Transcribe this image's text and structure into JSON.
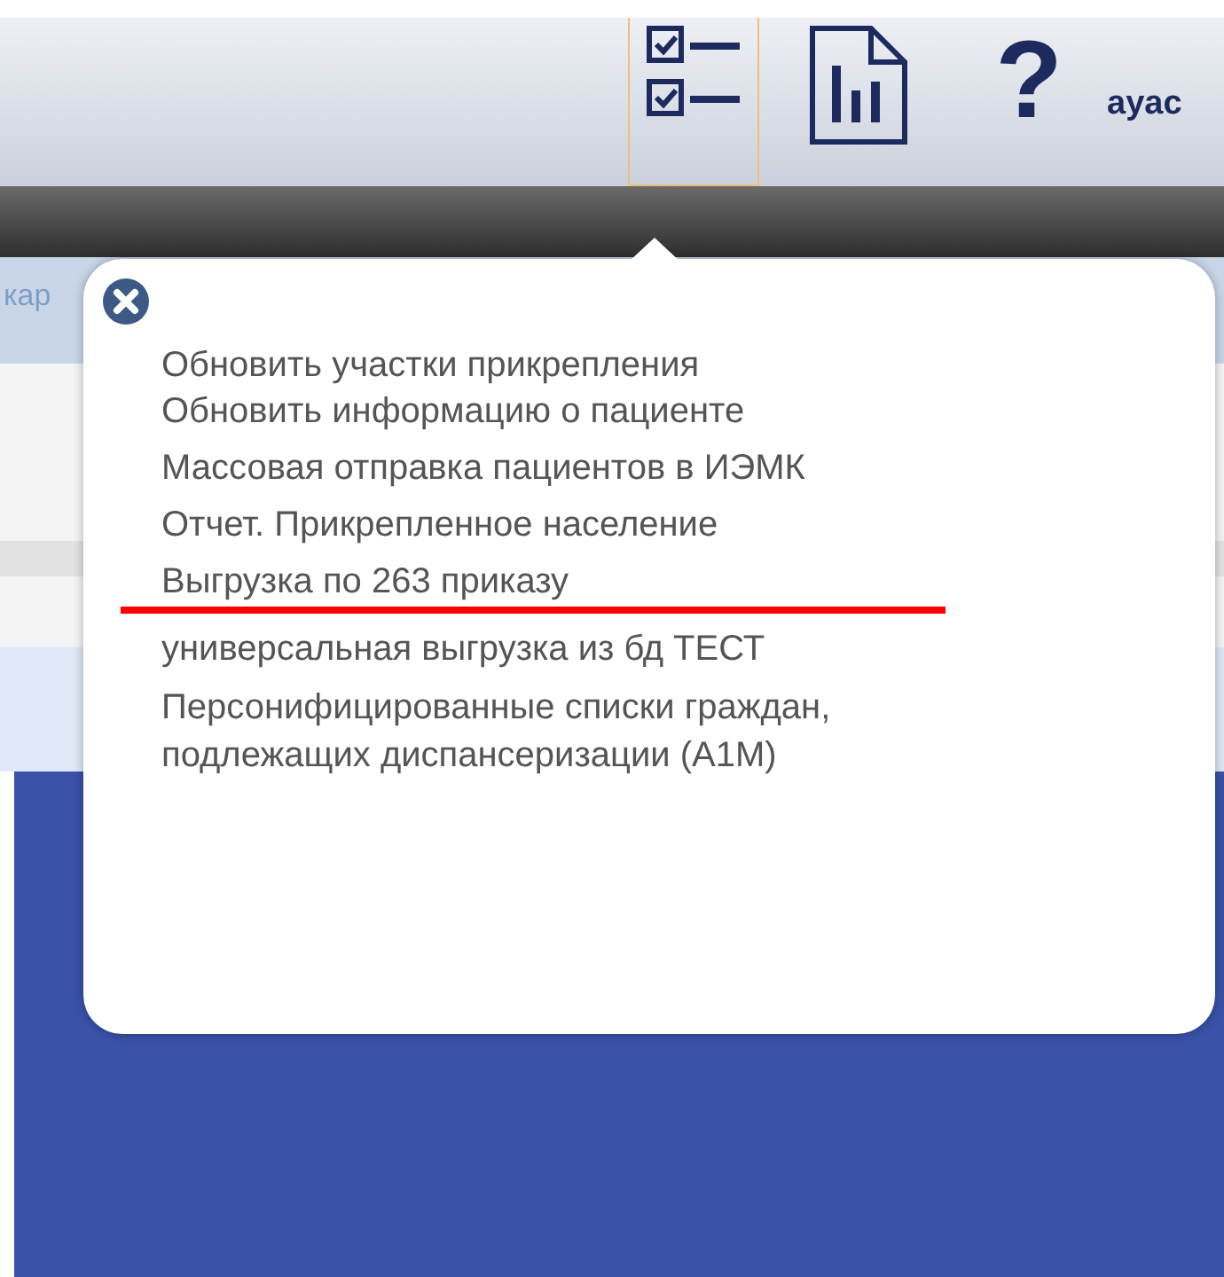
{
  "toolbar": {
    "buttons": [
      {
        "kind": "checklist",
        "selected": true
      },
      {
        "kind": "report",
        "selected": false
      },
      {
        "kind": "help",
        "label": "?",
        "selected": false
      }
    ],
    "user_name": "ayac"
  },
  "background": {
    "tab_label": "кар"
  },
  "menu": {
    "items": [
      {
        "label": "Обновить участки прикрепления",
        "underlined": false
      },
      {
        "label": "Обновить информацию о пациенте",
        "underlined": false
      },
      {
        "label": "Массовая отправка пациентов в ИЭМК",
        "underlined": false
      },
      {
        "label": "Отчет. Прикрепленное население",
        "underlined": false
      },
      {
        "label": "Выгрузка по 263 приказу",
        "underlined": true
      },
      {
        "label": "универсальная выгрузка из бд ТЕСТ",
        "underlined": false
      },
      {
        "label": "Персонифицированные списки граждан, подлежащих диспансеризации (А1М)",
        "underlined": false
      }
    ]
  }
}
